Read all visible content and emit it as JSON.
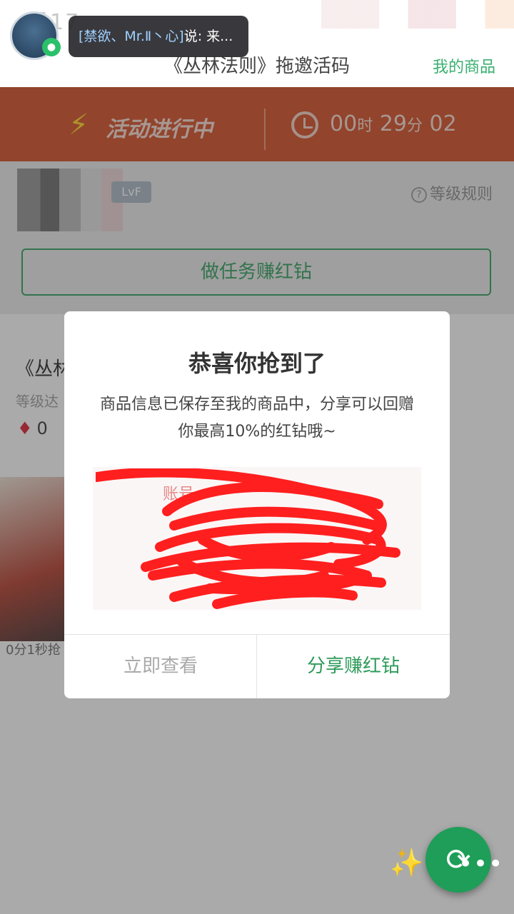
{
  "header": {
    "time_ghost": "晨17",
    "page_title": "《丛林法则》拖邀活码",
    "right_link": "我的商品",
    "notification": {
      "who": "[禁欲、Mr.Ⅱ丶心]",
      "text": "说: 来..."
    }
  },
  "banner": {
    "status": "活动进行中",
    "countdown": {
      "h": "00",
      "h_unit": "时",
      "m": "29",
      "m_unit": "分",
      "s": "02"
    }
  },
  "user": {
    "level_badge": "LvF",
    "level_rules": "等级规则",
    "task_button": "做任务赚红钻"
  },
  "product": {
    "title": "《丛林法则》激活码",
    "level_req": "等级达",
    "gems": "0",
    "countdown_text": "0分1秒抢"
  },
  "dialog": {
    "title": "恭喜你抢到了",
    "message": "商品信息已保存至我的商品中，分享可以回赠你最高10%的红钻哦~",
    "card_label": "账号",
    "left_button": "立即查看",
    "right_button": "分享赚红钻"
  },
  "icons": {
    "bolt": "bolt-icon",
    "clock": "alarm-clock-icon",
    "gem": "diamond-icon",
    "refresh": "refresh-icon",
    "magic": "magic-wand-icon"
  },
  "colors": {
    "accent_green": "#2e9b5a",
    "banner_orange": "#d14a22",
    "scribble_red": "#ff1f1f"
  }
}
